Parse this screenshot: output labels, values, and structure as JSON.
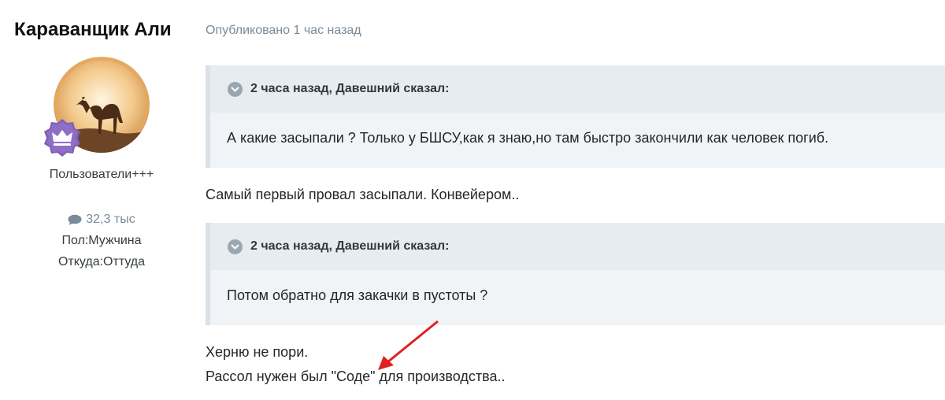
{
  "author": {
    "name": "Караванщик Али",
    "group": "Пользователи+++",
    "post_count": "32,3 тыс",
    "gender_line": "Пол:Мужчина",
    "location_line": "Откуда:Оттуда"
  },
  "post": {
    "published": "Опубликовано 1 час назад",
    "quotes": [
      {
        "citation": "2 часа назад, Давешний сказал:",
        "text": "А какие засыпали ?  Только у БШСУ,как я знаю,но там быстро закончили как человек погиб."
      },
      {
        "citation": "2 часа назад, Давешний сказал:",
        "text": "Потом обратно для закачки в пустоты ?"
      }
    ],
    "paragraphs": [
      "Самый первый провал засыпали. Конвейером..",
      "Херню не пори.",
      "Рассол нужен был \"Соде\" для производства.."
    ]
  },
  "colors": {
    "meta": "#7a8a99",
    "quote_bg": "#f1f4f7",
    "quote_head_bg": "#e7ecf1",
    "quote_border": "#dae1e8",
    "arrow": "#e02020",
    "badge": "#7e5fb5"
  },
  "icons": {
    "avatar": "camel-silhouette-avatar",
    "badge": "crown-badge-icon",
    "post_count": "comment-icon",
    "quote_toggle": "chevron-down-circle-icon",
    "annotation": "red-arrow"
  }
}
